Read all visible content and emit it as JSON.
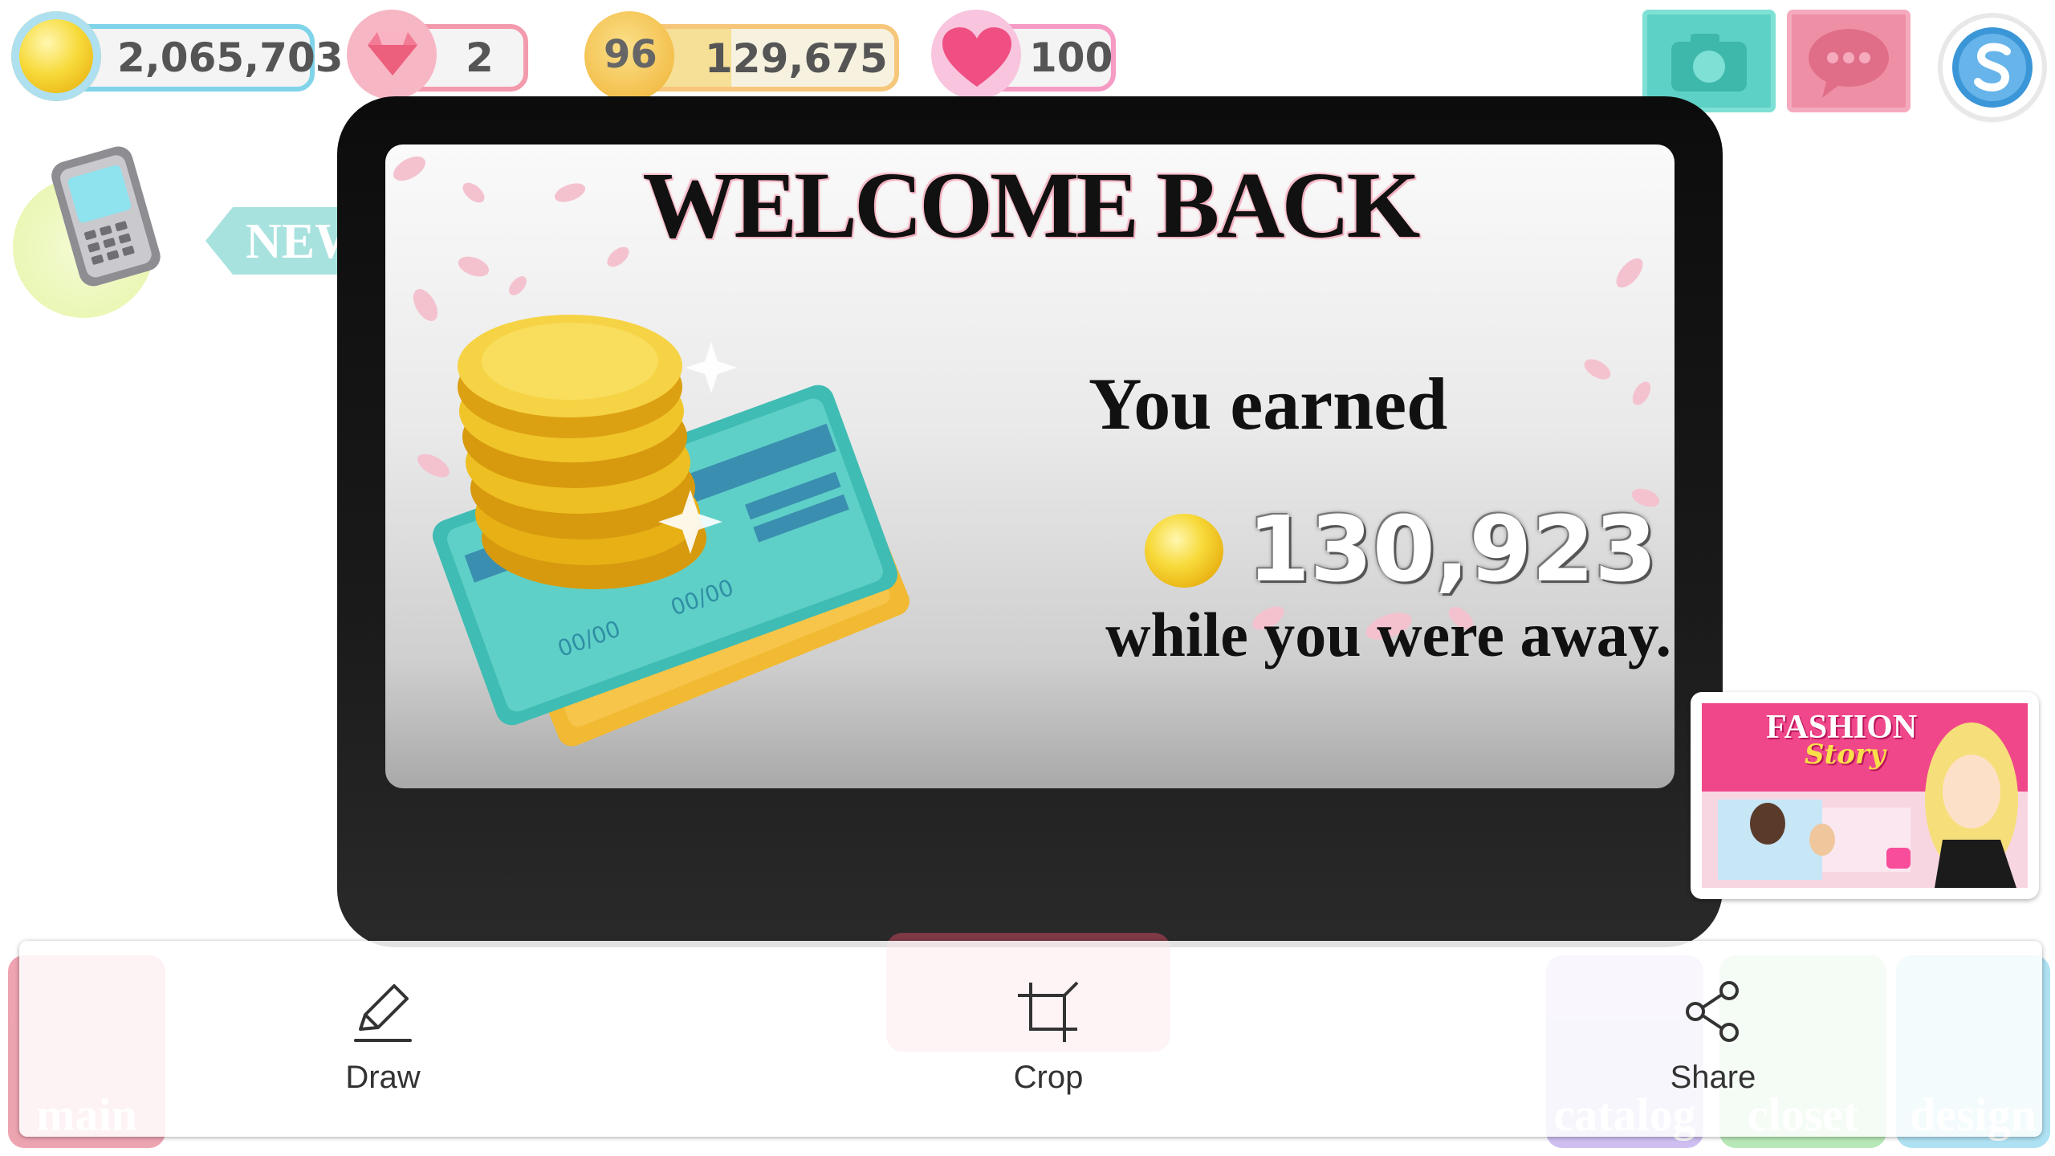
{
  "hud": {
    "coins": "2,065,703",
    "gems": "2",
    "level": "96",
    "xp": "129,675",
    "hearts": "100",
    "side_tag": "NEW"
  },
  "dialog": {
    "title": "WELCOME BACK",
    "line1": "You earned",
    "amount": "130,923",
    "line2": "while you were away."
  },
  "ad": {
    "title": "FASHION",
    "subtitle": "Story"
  },
  "bottom_tabs": [
    "main",
    "catalog",
    "closet",
    "design"
  ],
  "toolbar": {
    "draw_label": "Draw",
    "crop_label": "Crop",
    "share_label": "Share"
  },
  "colors": {
    "coin_gold": "#f7da3a",
    "gem_pink": "#f39aad",
    "camera_teal": "#5ed1c6",
    "chat_pink": "#ef8fa6",
    "s_blue": "#3b96d8"
  }
}
